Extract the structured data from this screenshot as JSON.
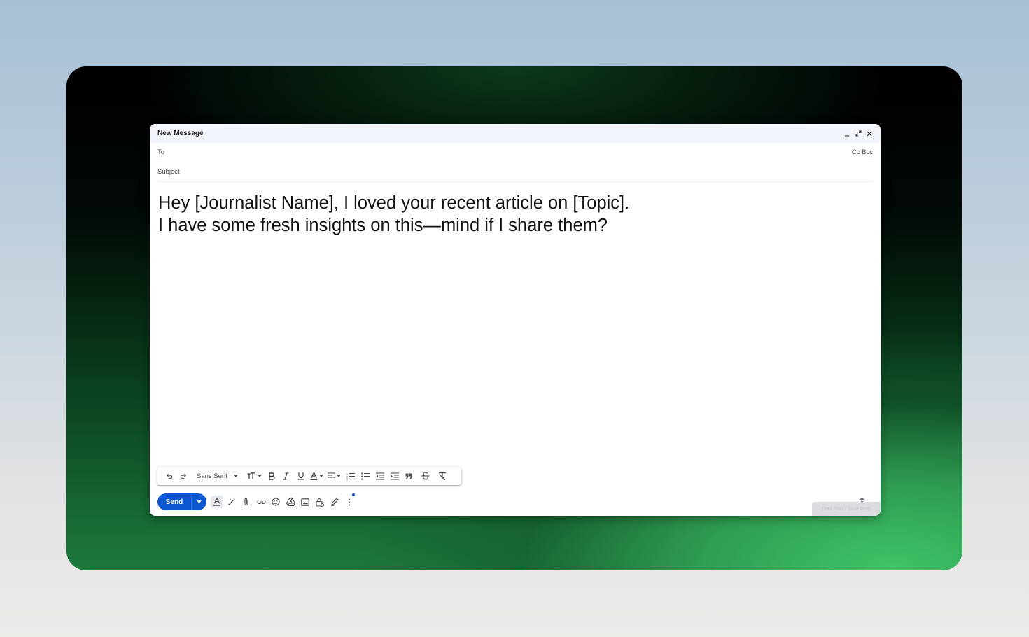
{
  "compose": {
    "title": "New Message",
    "to_label": "To",
    "cc_bcc_label": "Cc Bcc",
    "subject_label": "Subject",
    "body_lines": [
      "Hey [Journalist Name], I loved your recent article on [Topic].",
      "I have some fresh insights on this—mind if I share them?"
    ]
  },
  "formatting": {
    "font_family": "Sans Serif",
    "size_glyph": "ᴛT"
  },
  "bottom_bar": {
    "send_label": "Send",
    "ghost_label": "Start Plan / Save Draft"
  },
  "colors": {
    "send_button": "#0b57d0",
    "header_bg": "#f2f6fc",
    "notification_dot": "#0b57d0"
  }
}
